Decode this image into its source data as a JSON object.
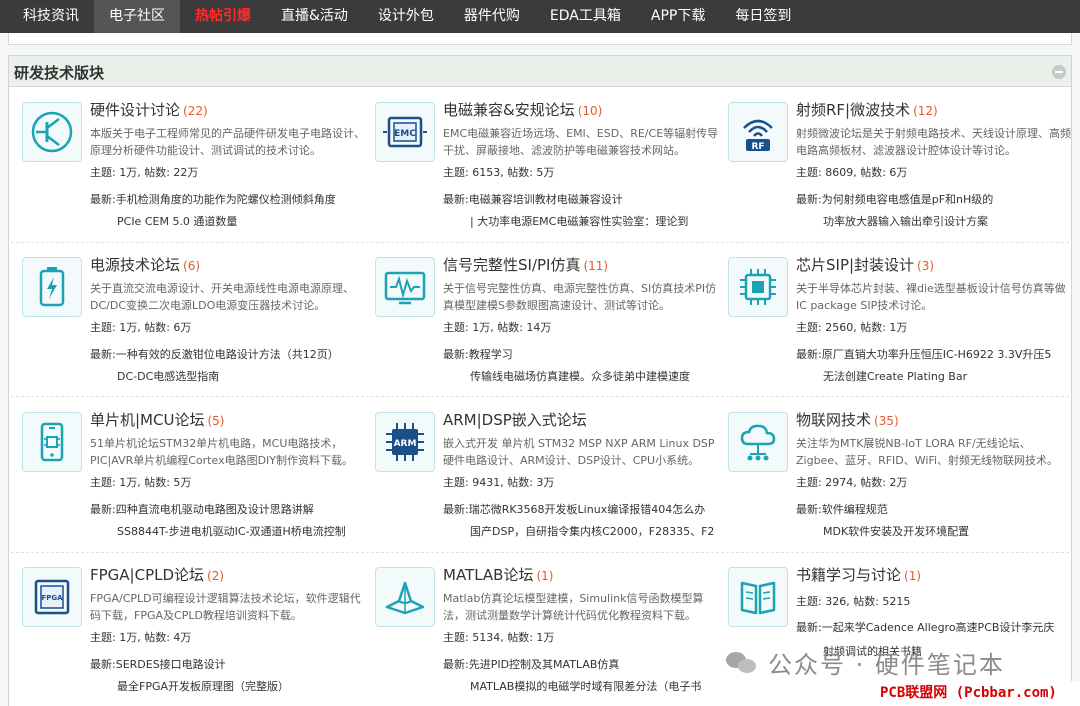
{
  "nav": {
    "items": [
      {
        "label": "科技资讯"
      },
      {
        "label": "电子社区"
      },
      {
        "label": "热帖引爆"
      },
      {
        "label": "直播&活动"
      },
      {
        "label": "设计外包"
      },
      {
        "label": "器件代购"
      },
      {
        "label": "EDA工具箱"
      },
      {
        "label": "APP下载"
      },
      {
        "label": "每日签到"
      }
    ]
  },
  "colors": {
    "nav_bg": "#3b3b3b",
    "panel_head_bg": "#e9f1ea",
    "count": "#e55a2b",
    "hot": "#ff2a2a",
    "icon_accent": "#1aa3b3"
  },
  "section": {
    "title": "研发技术版块"
  },
  "forums": [
    {
      "title": "硬件设计讨论",
      "count": "(22)",
      "icon": "transistor-icon",
      "desc": "本版关于电子工程师常见的产品硬件研发电子电路设计、原理分析硬件功能设计、测试调试的技术讨论。",
      "stats": "主题: 1万, 帖数: 22万",
      "latest1": "最新:手机检测角度的功能作为陀螺仪检测倾斜角度",
      "latest2": "PCIe CEM 5.0 通道数量"
    },
    {
      "title": "电磁兼容&安规论坛",
      "count": "(10)",
      "icon": "emc-icon",
      "icon_label": "EMC",
      "desc": "EMC电磁兼容近场远场、EMI、ESD、RE/CE等辐射传导干扰、屏蔽接地、滤波防护等电磁兼容技术网站。",
      "stats": "主题: 6153, 帖数: 5万",
      "latest1": "最新:电磁兼容培训教材电磁兼容设计",
      "latest2": "| 大功率电源EMC电磁兼容性实验室：理论到"
    },
    {
      "title": "射频RF|微波技术",
      "count": "(12)",
      "icon": "rf-icon",
      "icon_label": "RF",
      "desc": "射频微波论坛是关于射频电路技术、天线设计原理、高频电路高频板材、滤波器设计腔体设计等讨论。",
      "stats": "主题: 8609, 帖数: 6万",
      "latest1": "最新:为何射频电容电感值是pF和nH级的",
      "latest2": "功率放大器输入输出牵引设计方案"
    },
    {
      "title": "电源技术论坛",
      "count": "(6)",
      "icon": "battery-icon",
      "desc": "关于直流交流电源设计、开关电源线性电源电源原理、DC/DC变换二次电源LDO电源变压器技术讨论。",
      "stats": "主题: 1万, 帖数: 6万",
      "latest1": "最新:一种有效的反激钳位电路设计方法（共12页）",
      "latest2": "DC-DC电感选型指南"
    },
    {
      "title": "信号完整性SI/PI仿真",
      "count": "(11)",
      "icon": "oscilloscope-icon",
      "desc": "关于信号完整性仿真、电源完整性仿真、SI仿真技术PI仿真模型建模S参数眼图高速设计、测试等讨论。",
      "stats": "主题: 1万, 帖数: 14万",
      "latest1": "最新:教程学习",
      "latest2": "传输线电磁场仿真建模。众多徒弟中建模速度"
    },
    {
      "title": "芯片SIP|封装设计",
      "count": "(3)",
      "icon": "chip-icon",
      "desc": "关于半导体芯片封装、裸die选型基板设计信号仿真等做IC package SIP技术讨论。",
      "stats": "主题: 2560, 帖数: 1万",
      "latest1": "最新:原厂直销大功率升压恒压IC-H6922 3.3V升压5",
      "latest2": "无法创建Create Plating Bar"
    },
    {
      "title": "单片机|MCU论坛",
      "count": "(5)",
      "icon": "mcu-phone-icon",
      "desc": "51单片机论坛STM32单片机电路，MCU电路技术，PIC|AVR单片机编程Cortex电路图DIY制作资料下载。",
      "stats": "主题: 1万, 帖数: 5万",
      "latest1": "最新:四种直流电机驱动电路图及设计思路讲解",
      "latest2": "SS8844T-步进电机驱动IC-双通道H桥电流控制"
    },
    {
      "title": "ARM|DSP嵌入式论坛",
      "count": "",
      "icon": "arm-chip-icon",
      "icon_label": "ARM",
      "desc": "嵌入式开发 单片机 STM32 MSP NXP ARM Linux DSP硬件电路设计、ARM设计、DSP设计、CPU小系统。",
      "stats": "主题: 9431, 帖数: 3万",
      "latest1": "最新:瑞芯微RK3568开发板Linux编译报错404怎么办",
      "latest2": "国产DSP，自研指令集内核C2000，F28335、F2"
    },
    {
      "title": "物联网技术",
      "count": "(35)",
      "icon": "cloud-iot-icon",
      "desc": "关注华为MTK展锐NB-IoT LORA RF/无线论坛、Zigbee、蓝牙、RFID、WiFi、射频无线物联网技术。",
      "stats": "主题: 2974, 帖数: 2万",
      "latest1": "最新:软件编程规范",
      "latest2": "MDK软件安装及开发环境配置"
    },
    {
      "title": "FPGA|CPLD论坛",
      "count": "(2)",
      "icon": "fpga-icon",
      "icon_label": "FPGA",
      "desc": "FPGA/CPLD可编程设计逻辑算法技术论坛，软件逻辑代码下载，FPGA及CPLD教程培训资料下载。",
      "stats": "主题: 1万, 帖数: 4万",
      "latest1": "最新:SERDES接口电路设计",
      "latest2": "最全FPGA开发板原理图（完整版）"
    },
    {
      "title": "MATLAB论坛",
      "count": "(1)",
      "icon": "matlab-icon",
      "desc": "Matlab仿真论坛模型建模，Simulink信号函数模型算法，测试测量数学计算统计代码优化教程资料下载。",
      "stats": "主题: 5134, 帖数: 1万",
      "latest1": "最新:先进PID控制及其MATLAB仿真",
      "latest2": "MATLAB模拟的电磁学时域有限差分法（电子书"
    },
    {
      "title": "书籍学习与讨论",
      "count": "(1)",
      "icon": "book-icon",
      "desc": "",
      "stats": "主题: 326, 帖数: 5215",
      "latest1": "最新:一起来学Cadence Allegro高速PCB设计李元庆",
      "latest2": "射频调试的相关书籍"
    }
  ],
  "watermark": {
    "text": "公众号 · 硬件笔记本"
  },
  "site_tag": {
    "text": "PCB联盟网 (Pcbbar.com)"
  }
}
